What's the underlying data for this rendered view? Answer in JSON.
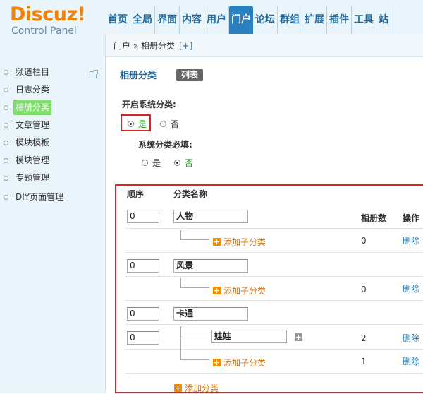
{
  "logo": {
    "title": "Discuz!",
    "subtitle": "Control Panel"
  },
  "nav": [
    "首页",
    "全局",
    "界面",
    "内容",
    "用户",
    "门户",
    "论坛",
    "群组",
    "扩展",
    "插件",
    "工具",
    "站"
  ],
  "nav_active": "门户",
  "sidebar": [
    "频道栏目",
    "日志分类",
    "相册分类",
    "文章管理",
    "模块模板",
    "模块管理",
    "专题管理",
    "DIY页面管理"
  ],
  "breadcrumb": {
    "path": "门户 » 相册分类",
    "add": "[+]"
  },
  "main": {
    "title": "相册分类",
    "list_button": "列表",
    "enable_label": "开启系统分类:",
    "enable_yes": "是",
    "enable_no": "否",
    "required_label": "系统分类必填:",
    "required_yes": "是",
    "required_no": "否"
  },
  "table": {
    "headers": {
      "order": "顺序",
      "name": "分类名称",
      "count": "相册数",
      "ops": "操作"
    },
    "rows": [
      {
        "order": "0",
        "name": "人物",
        "add_sub": "添加子分类",
        "count": "0",
        "delete": "删除"
      },
      {
        "order": "0",
        "name": "风景",
        "add_sub": "添加子分类",
        "count": "0",
        "delete": "删除"
      },
      {
        "order": "0",
        "name": "卡通",
        "child_order": "0",
        "child_name": "娃娃",
        "child_count": "2",
        "child_delete": "删除",
        "add_sub": "添加子分类",
        "count": "1",
        "delete": "删除"
      }
    ],
    "add_category": "添加分类"
  },
  "colors": {
    "accent": "#2a7fc0",
    "highlight": "#dd2222",
    "add": "#f28b00",
    "active_sidebar": "#7ee06b"
  }
}
